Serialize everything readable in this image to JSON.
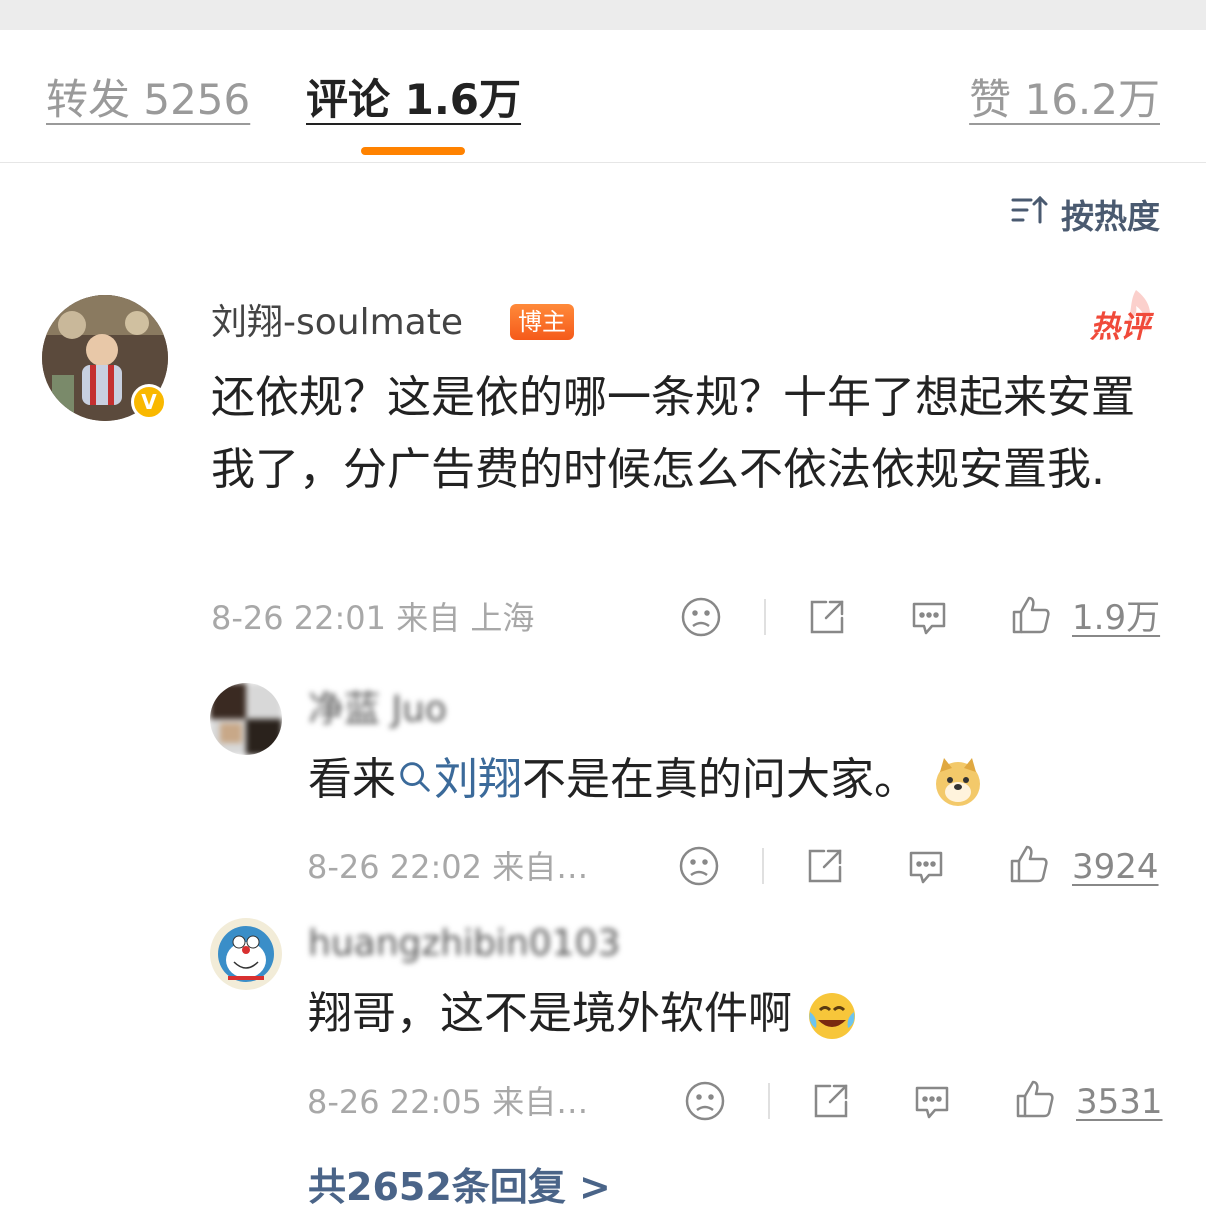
{
  "tabs": {
    "repost": "转发 5256",
    "comment": "评论 1.6万",
    "like": "赞 16.2万"
  },
  "sort": {
    "label": "按热度"
  },
  "main_comment": {
    "username": "刘翔-soulmate",
    "badge": "博主",
    "hot_label": "热评",
    "body": "还依规？这是依的哪一条规？十年了想起来安置我了，分广告费的时候怎么不依法依规安置我.",
    "time": "8-26 22:01",
    "location": "来自 上海",
    "likes": "1.9万"
  },
  "replies": [
    {
      "username": "净蓝 Juo",
      "body_prefix": "看来",
      "body_link": "刘翔",
      "body_suffix": "不是在真的问大家。",
      "emoji": "doge-emoji",
      "time": "8-26 22:02",
      "location": "来自…",
      "likes": "3924"
    },
    {
      "username": "huangzhibin0103",
      "body": "翔哥，这不是境外软件啊",
      "emoji": "laugh-cry-emoji",
      "time": "8-26 22:05",
      "location": "来自…",
      "likes": "3531"
    }
  ],
  "more_replies": "共2652条回复 >",
  "colors": {
    "accent": "#ff8200",
    "link": "#3b6a9a",
    "badge": "#f55a1a",
    "verified": "#f9b800"
  }
}
